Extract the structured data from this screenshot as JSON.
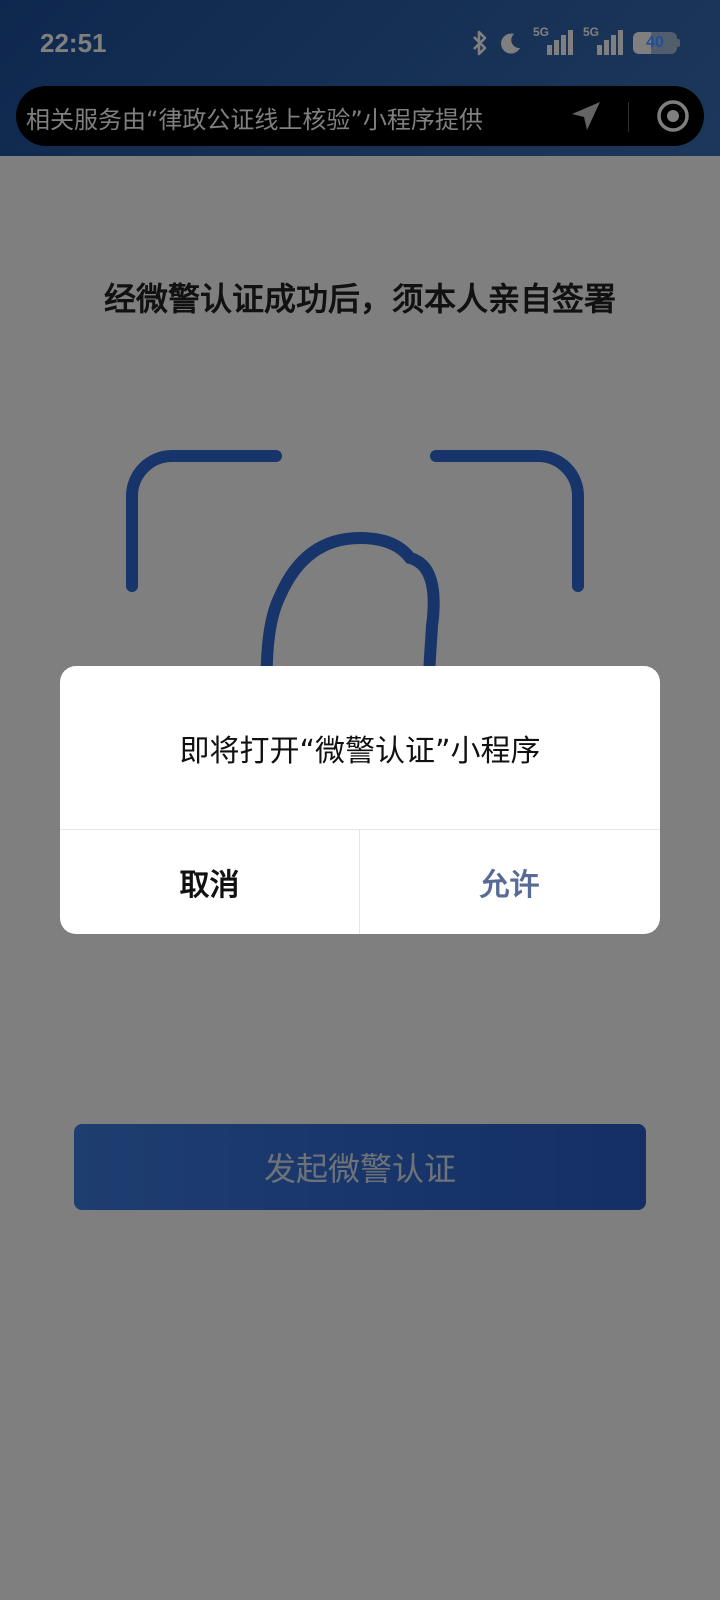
{
  "status_bar": {
    "time": "22:51",
    "network_1": "5G",
    "network_2": "5G",
    "battery": "40",
    "battery_level_percent": 40,
    "icons": [
      "bluetooth-icon",
      "moon-icon",
      "signal-icon",
      "signal-icon",
      "battery-icon"
    ]
  },
  "banner": {
    "text": "相关服务由“律政公证线上核验”小程序提供",
    "icons": [
      "location-arrow-icon",
      "target-icon"
    ]
  },
  "page": {
    "heading": "经微警认证成功后，须本人亲自签署",
    "start_button_label": "发起微警认证",
    "accent_color": "#2f6ad4"
  },
  "dialog": {
    "message": "即将打开“微警认证”小程序",
    "cancel_label": "取消",
    "allow_label": "允许",
    "allow_color": "#576b95"
  }
}
